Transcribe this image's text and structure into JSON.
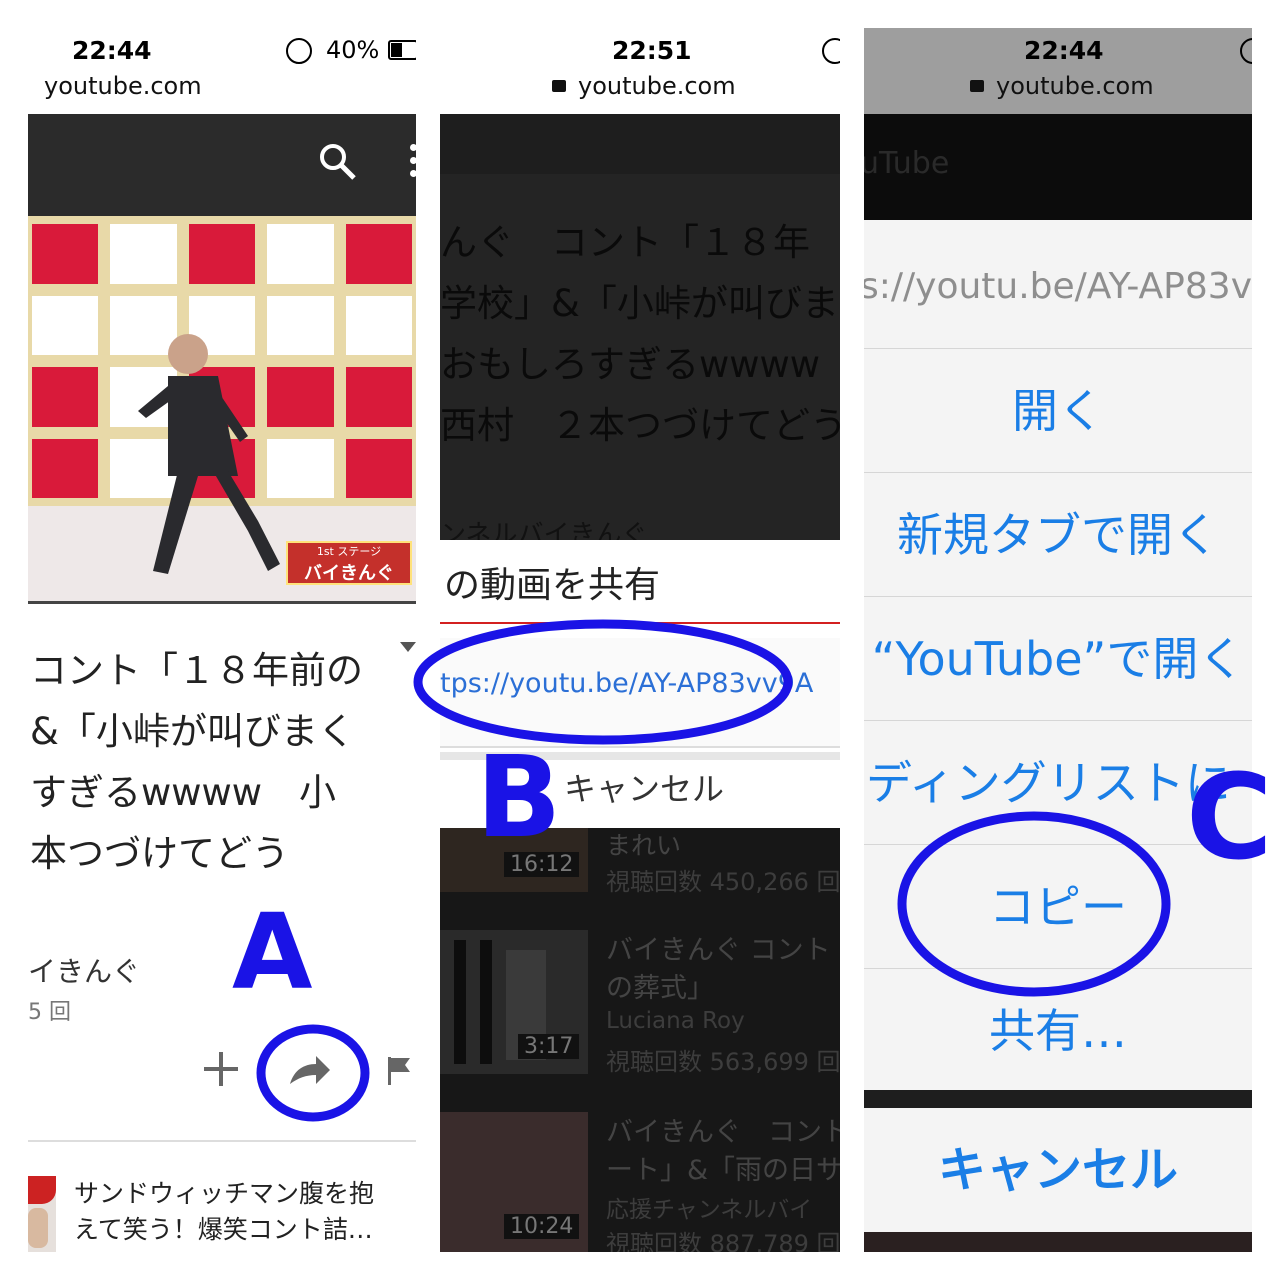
{
  "panel1": {
    "status": {
      "time": "22:44",
      "battery": "40%"
    },
    "address": "youtube.com",
    "video_title_lines": [
      "コント「１８年前の",
      "&「小峠が叫びまく",
      "すぎるwwww　小",
      "本つづけてどう"
    ],
    "channel_name": "イきんぐ",
    "view_count_partial": "5 回",
    "thumb_badge_top": "1st ステージ",
    "thumb_badge_main": "バイきんぐ",
    "actions": {
      "add_icon": "plus-icon",
      "share_icon": "share-arrow-icon",
      "flag_icon": "flag-icon"
    },
    "next_video_lines": [
      "サンドウィッチマン腹を抱",
      "えて笑う！爆笑コント詰…"
    ],
    "marker": "A"
  },
  "panel2": {
    "status": {
      "time": "22:51"
    },
    "address": "youtube.com",
    "bg_title_lines": [
      "んぐ　コント「１８年",
      "学校」&「小峠が叫びま",
      "おもしろすぎるwwww",
      "西村　２本つづけてどう"
    ],
    "bg_channel_partial": "ンネルバイきんぐ",
    "share_heading": "の動画を共有",
    "share_url": "tps://youtu.be/AY-AP83vv9A",
    "cancel_label": "キャンセル",
    "list": [
      {
        "title": "まれい",
        "meta": "視聴回数 450,266 回",
        "duration": "16:12"
      },
      {
        "title": "バイきんぐ コント",
        "title2": "の葬式」",
        "channel": "Luciana Roy",
        "meta": "視聴回数 563,699 回",
        "duration": "3:17"
      },
      {
        "title": "バイきんぐ　コント",
        "title2": "ート」&「雨の日サ",
        "channel": "応援チャンネルバイ",
        "meta": "視聴回数 887,789 回",
        "duration": "10:24"
      }
    ],
    "marker": "B"
  },
  "panel3": {
    "status": {
      "time": "22:44"
    },
    "address": "youtube.com",
    "bg_header": "uTube",
    "url_preview": "s://youtu.be/AY-AP83v",
    "menu": [
      "開く",
      "新規タブで開く",
      "“YouTube”で開く",
      "ディングリストに",
      "コピー",
      "共有…"
    ],
    "cancel_label": "キャンセル",
    "marker": "C"
  },
  "colors": {
    "ios_blue": "#1a7ee6",
    "marker_blue": "#1a13e6",
    "youtube_red": "#d32020"
  }
}
